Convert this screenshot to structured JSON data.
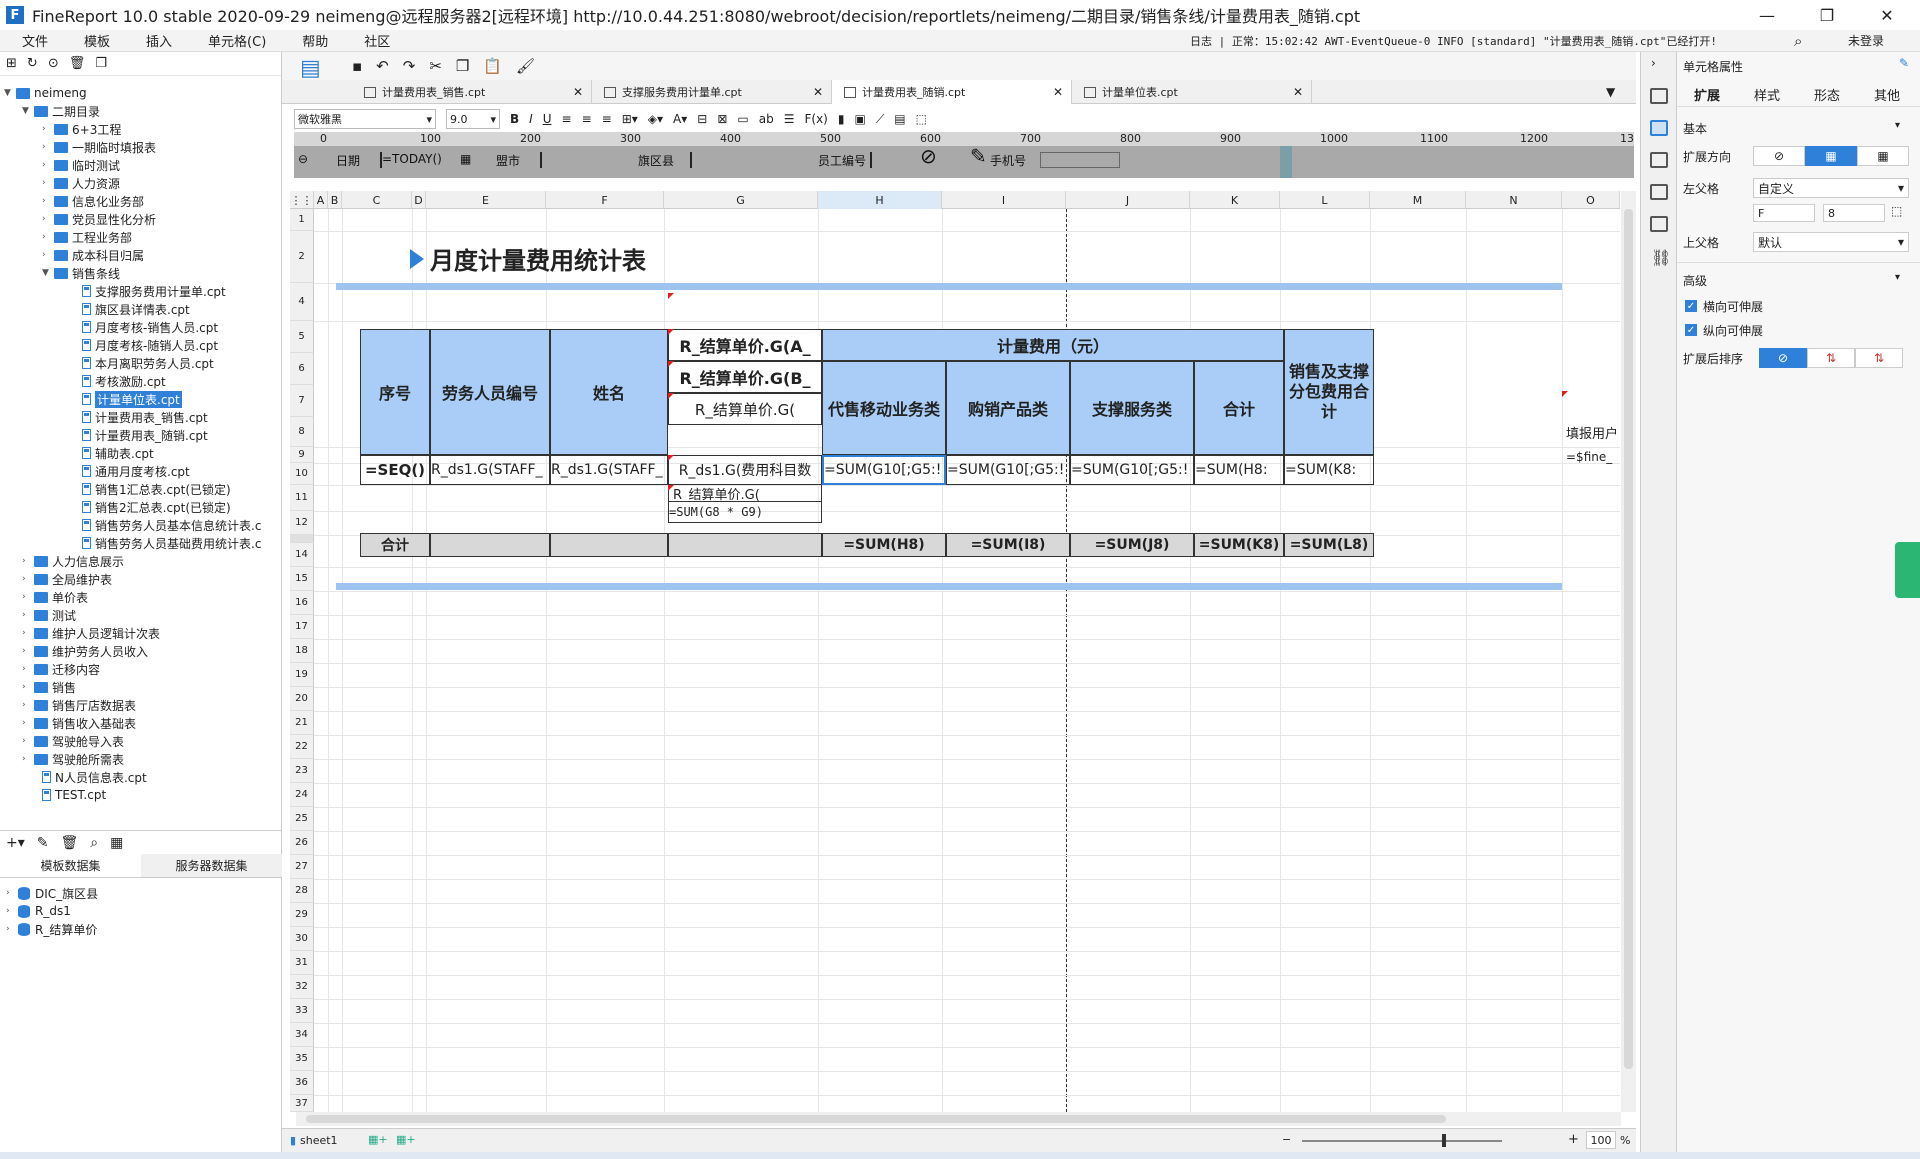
{
  "titlebar": {
    "logo": "F",
    "title": "FineReport 10.0 stable 2020-09-29 neimeng@远程服务器2[远程环境]    http://10.0.44.251:8080/webroot/decision/reportlets/neimeng/二期目录/销售条线/计量费用表_随销.cpt",
    "minimize": "—",
    "restore": "❐",
    "close": "✕"
  },
  "menubar": {
    "items": [
      "文件",
      "模板",
      "插入",
      "单元格(C)",
      "帮助",
      "社区"
    ],
    "status": "日志 | 正常：15:02:42 AWT-EventQueue-0 INFO [standard] \"计量费用表_随销.cpt\"已经打开!",
    "login": "未登录"
  },
  "tree": {
    "root": "neimeng",
    "level1": "二期目录",
    "folders_a": [
      "6+3工程",
      "一期临时填报表",
      "临时测试",
      "人力资源",
      "信息化业务部",
      "党员显性化分析",
      "工程业务部",
      "成本科目归属"
    ],
    "open_folder": "销售条线",
    "files": [
      "支撑服务费用计量单.cpt",
      "旗区县详情表.cpt",
      "月度考核-销售人员.cpt",
      "月度考核-随销人员.cpt",
      "本月离职劳务人员.cpt",
      "考核激励.cpt",
      "计量单位表.cpt",
      "计量费用表_销售.cpt",
      "计量费用表_随销.cpt",
      "辅助表.cpt",
      "通用月度考核.cpt",
      "销售1汇总表.cpt(已锁定)",
      "销售2汇总表.cpt(已锁定)",
      "销售劳务人员基本信息统计表.c",
      "销售劳务人员基础费用统计表.c"
    ],
    "selected_file": "计量单位表.cpt",
    "folders_b": [
      "人力信息展示",
      "全局维护表",
      "单价表",
      "测试",
      "维护人员逻辑计次表",
      "维护劳务人员收入",
      "迁移内容",
      "销售",
      "销售厅店数据表",
      "销售收入基础表",
      "驾驶舱导入表",
      "驾驶舱所需表"
    ],
    "root_files": [
      "N人员信息表.cpt",
      "TEST.cpt"
    ]
  },
  "datasets": {
    "tabs": [
      "模板数据集",
      "服务器数据集"
    ],
    "items": [
      "DIC_旗区县",
      "R_ds1",
      "R_结算单价"
    ]
  },
  "filetabs": [
    "计量费用表_销售.cpt",
    "支撑服务费用计量单.cpt",
    "计量费用表_随销.cpt",
    "计量单位表.cpt"
  ],
  "format": {
    "font": "微软雅黑",
    "size": "9.0"
  },
  "params": {
    "ruler": [
      "0",
      "100",
      "200",
      "300",
      "400",
      "500",
      "600",
      "700",
      "800",
      "900",
      "1000",
      "1100",
      "1200",
      "13"
    ],
    "date_label": "日期",
    "date_value": "=TODAY()",
    "league_label": "盟市",
    "county_label": "旗区县",
    "staff_label": "员工编号",
    "phone_label": "手机号"
  },
  "sheet": {
    "columns": [
      "A",
      "B",
      "C",
      "D",
      "E",
      "F",
      "G",
      "H",
      "I",
      "J",
      "K",
      "L",
      "M",
      "N",
      "O"
    ],
    "rows": [
      "1",
      "2",
      "4",
      "5",
      "6",
      "7",
      "8",
      "9",
      "10",
      "11",
      "12",
      "14",
      "15",
      "16",
      "17",
      "18",
      "19",
      "20",
      "21",
      "22",
      "23",
      "24",
      "25",
      "26",
      "27",
      "28",
      "29",
      "30",
      "31",
      "32",
      "33",
      "34",
      "35",
      "36",
      "37"
    ],
    "title": "月度计量费用统计表",
    "h_seq": "序号",
    "h_staff": "劳务人员编号",
    "h_name": "姓名",
    "h_g5": "R_结算单价.G(A_",
    "h_g6": "R_结算单价.G(B_",
    "h_g7": "R_结算单价.G(",
    "h_cost": "计量费用（元）",
    "h_mobile": "代售移动业务类",
    "h_buy": "购销产品类",
    "h_support": "支撑服务类",
    "h_total": "合计",
    "h_sales": "销售及支撑分包费用合计",
    "d_seq": "=SEQ()",
    "d_staff": "R_ds1.G(STAFF_",
    "d_name": "R_ds1.G(STAFF_",
    "d_g8": "R_ds1.G(费用科目数",
    "d_h8": "=SUM(G10[;G5:!",
    "d_i8": "=SUM(G10[;G5:!",
    "d_j8": "=SUM(G10[;G5:!",
    "d_k8": "=SUM(H8:",
    "d_l8": "=SUM(K8:",
    "d_g9": "R_结算单价.G(",
    "d_g10": "=SUM(G8 * G9)",
    "t_label": "合计",
    "t_h": "=SUM(H8)",
    "t_i": "=SUM(I8)",
    "t_j": "=SUM(J8)",
    "t_k": "=SUM(K8)",
    "t_l": "=SUM(L8)",
    "o7": "填报用户",
    "o8": "=$fine_"
  },
  "bottom": {
    "sheet": "sheet1",
    "zoom": "100",
    "pct": "%"
  },
  "rpanel": {
    "title": "单元格属性",
    "tabs": [
      "扩展",
      "样式",
      "形态",
      "其他"
    ],
    "basic": "基本",
    "direction": "扩展方向",
    "left_parent": "左父格",
    "left_parent_value": "自定义",
    "left_col": "F",
    "left_row": "8",
    "up_parent": "上父格",
    "up_parent_value": "默认",
    "advanced": "高级",
    "h_expand": "横向可伸展",
    "v_expand": "纵向可伸展",
    "sort": "扩展后排序"
  }
}
